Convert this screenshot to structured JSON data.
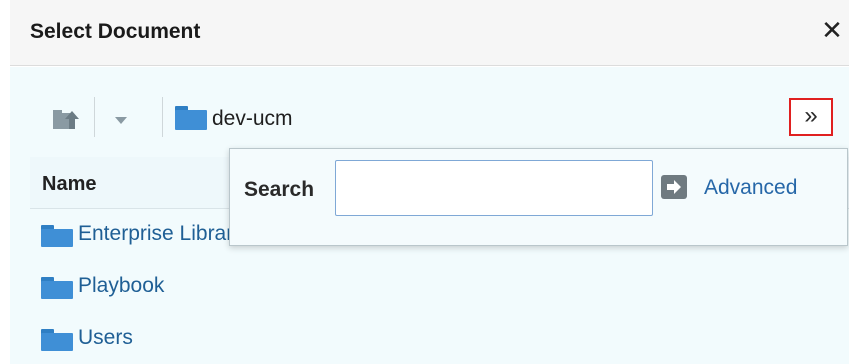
{
  "dialog": {
    "title": "Select Document",
    "close_symbol": "✕"
  },
  "toolbar": {
    "up_icon": "folder-up-icon",
    "dropdown_icon": "chevron-down-icon",
    "breadcrumb": {
      "label": "dev-ucm",
      "icon": "folder-icon"
    },
    "overflow_label": "»",
    "overflow_highlight_color": "#e02020"
  },
  "table": {
    "columns": [
      "Name"
    ],
    "rows": [
      {
        "label": "Enterprise Libraries",
        "icon": "folder-icon"
      },
      {
        "label": "Playbook",
        "icon": "folder-icon"
      },
      {
        "label": "Users",
        "icon": "folder-icon"
      }
    ]
  },
  "search_popup": {
    "label": "Search",
    "input_value": "",
    "go_icon": "arrow-right-icon",
    "advanced_label": "Advanced"
  },
  "colors": {
    "folder_blue": "#3f8fd6",
    "link_blue": "#2667a8",
    "body_bg": "#f2fbfd"
  }
}
